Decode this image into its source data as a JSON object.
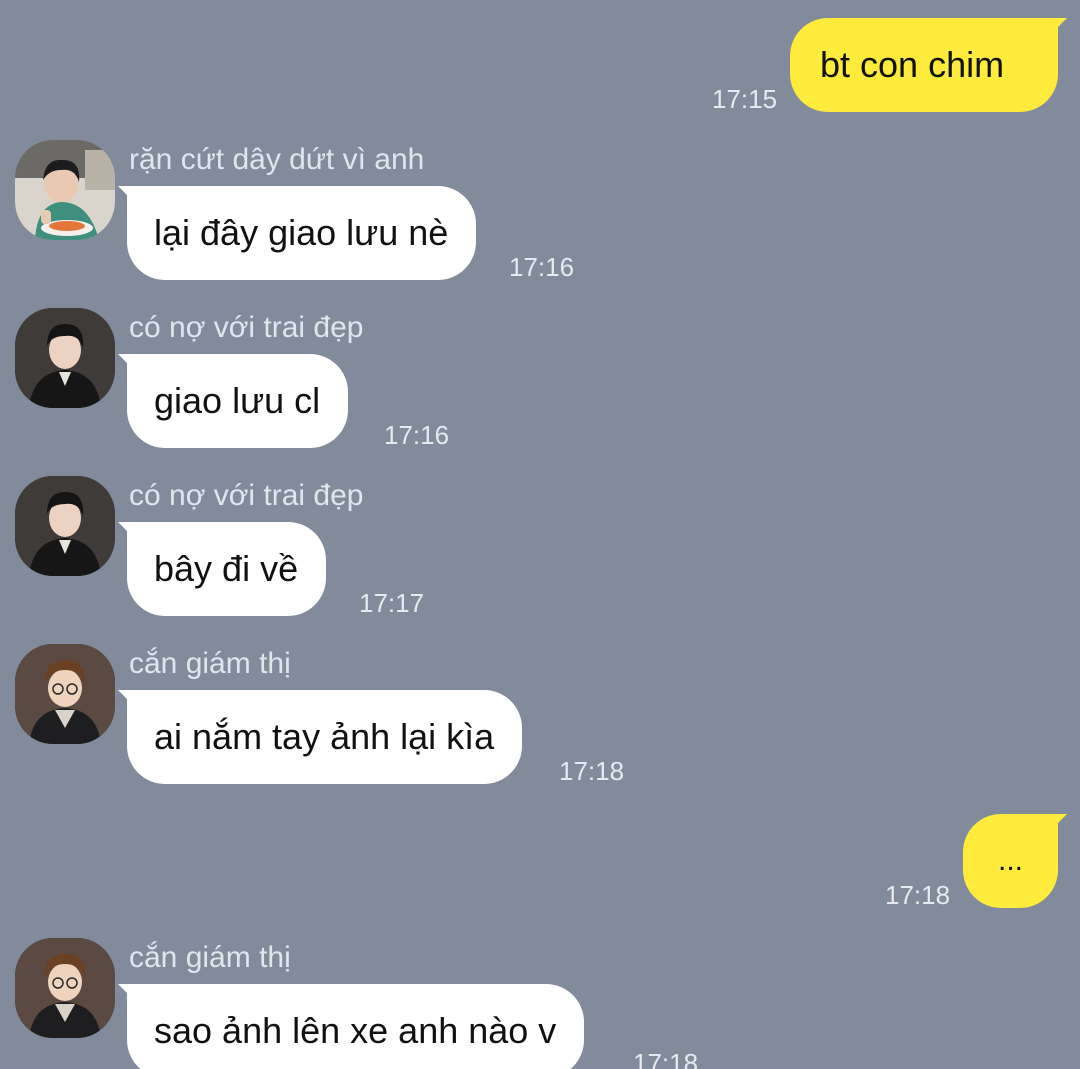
{
  "colors": {
    "background": "#828b9c",
    "outgoing_bubble": "#ffeb3b",
    "incoming_bubble": "#ffffff",
    "sender_text": "#e1e5ec",
    "timestamp_text": "#e6e9ee"
  },
  "messages": [
    {
      "direction": "outgoing",
      "text": "bt con chim",
      "time": "17:15"
    },
    {
      "direction": "incoming",
      "sender": "rặn cứt dây dứt vì anh",
      "avatar": "avatar-photo-boy-eating-icon",
      "text": "lại đây giao lưu nè",
      "time": "17:16"
    },
    {
      "direction": "incoming",
      "sender": "có nợ với trai đẹp",
      "avatar": "avatar-photo-boy-black-jacket-icon",
      "text": "giao lưu cl",
      "time": "17:16"
    },
    {
      "direction": "incoming",
      "sender": "có nợ với trai đẹp",
      "avatar": "avatar-photo-boy-black-jacket-icon",
      "text": "bây đi về",
      "time": "17:17"
    },
    {
      "direction": "incoming",
      "sender": "cắn giám thị",
      "avatar": "avatar-photo-boy-glasses-icon",
      "text": "ai nắm tay ảnh lại kìa",
      "time": "17:18"
    },
    {
      "direction": "outgoing",
      "text": "...",
      "time": "17:18"
    },
    {
      "direction": "incoming",
      "sender": "cắn giám thị",
      "avatar": "avatar-photo-boy-glasses-icon",
      "text": "sao ảnh lên xe anh nào v",
      "time": "17:18"
    }
  ]
}
